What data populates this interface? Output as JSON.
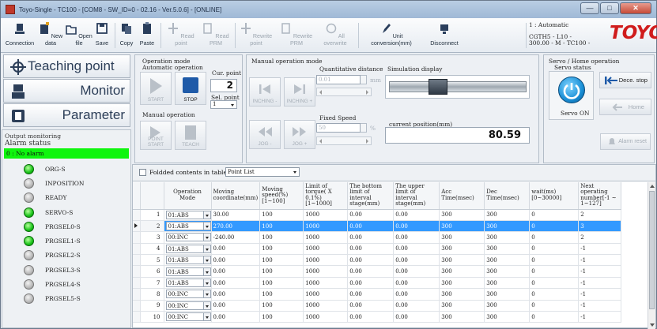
{
  "window": {
    "title": "Toyo-Single - TC100 - [COM8 - SW_ID=0 - 02.16 - Ver.5.0.6] - [ONLINE]",
    "min_label": "—",
    "max_label": "□",
    "close_label": "✕"
  },
  "toolbar": {
    "connection": "Connection",
    "new_data": "New data",
    "open_file": "Open file",
    "save": "Save",
    "copy": "Copy",
    "paste": "Paste",
    "read_point": "Read point",
    "read_prm": "Read PRM",
    "rewrite_point": "Rewrite point",
    "rewrite_prm": "Rewrite PRM",
    "all_overwrite": "All overwrite",
    "unit_conversion": "Unit conversion(mm)",
    "disconnect": "Disconnect"
  },
  "robot_info": {
    "line1": "1 : Automatic",
    "line2": "CGTH5 - L10 -",
    "line3": "300.00 - M - TC100 -",
    "logo": "TOYO"
  },
  "nav": {
    "teaching_point": "Teaching point",
    "monitor": "Monitor",
    "parameter": "Parameter"
  },
  "output_monitoring": {
    "title": "Output monitoring",
    "alarm_status": "Alarm status",
    "alarm_value": "0 : No alarm",
    "signals": [
      {
        "name": "ORG-S",
        "state": "on"
      },
      {
        "name": "INPOSITION",
        "state": "off"
      },
      {
        "name": "READY",
        "state": "off"
      },
      {
        "name": "SERVO-S",
        "state": "on"
      },
      {
        "name": "PRGSEL0-S",
        "state": "on"
      },
      {
        "name": "PRGSEL1-S",
        "state": "on"
      },
      {
        "name": "PRGSEL2-S",
        "state": "off"
      },
      {
        "name": "PRGSEL3-S",
        "state": "off"
      },
      {
        "name": "PRGSEL4-S",
        "state": "off"
      },
      {
        "name": "PRGSEL5-S",
        "state": "off"
      }
    ]
  },
  "operation_mode": {
    "title": "Operation mode",
    "automatic": "Automatic operation",
    "start": "START",
    "stop": "STOP",
    "cur_point_label": "Cur. point",
    "cur_point_value": "2",
    "sel_point_label": "Sel. point",
    "sel_point_value": "1",
    "manual": "Manual operation",
    "point_start": "POINT START",
    "teach": "TEACH"
  },
  "manual_mode": {
    "title": "Manual operation mode",
    "inching_minus": "INCHING -",
    "inching_plus": "INCHING +",
    "jog_minus": "JOG -",
    "jog_plus": "JOG +",
    "qty_distance_label": "Quantitative distance",
    "qty_distance_value": "0.01",
    "qty_unit": "mm",
    "fixed_speed_label": "Fixed Speed",
    "fixed_speed_value": "50",
    "fixed_speed_unit": "%",
    "sim_label": "Simulation display",
    "current_position_label": "current position(mm)",
    "current_position_value": "80.59"
  },
  "servo": {
    "title": "Servo / Home operation",
    "status_label": "Servo status",
    "servo_on": "Servo ON",
    "dece_stop": "Dece. stop",
    "home": "Home",
    "alarm_reset": "Alarm reset"
  },
  "table": {
    "folded_label": "Foldded contents in table",
    "view_select": "Point List",
    "headers": [
      "",
      "Operation Mode",
      "Moving coordinate(mm)",
      "Moving speed(%)[1~100]",
      "Limit of torque( X 0.1%)[1~1000]",
      "The bottom limit of interval stage(mm)",
      "The upper limit of interval stage(mm)",
      "Acc Time(msec)",
      "Dec Time(msec)",
      "wait(ms)[0~30000]",
      "Next operating number[-1 ~ 1~127]"
    ],
    "rows": [
      {
        "n": "1",
        "mode": "01:ABS",
        "coord": "30.00",
        "speed": "100",
        "torque": "1000",
        "bottom": "0.00",
        "upper": "0.00",
        "acc": "300",
        "dec": "300",
        "wait": "0",
        "next": "2"
      },
      {
        "n": "2",
        "mode": "01:ABS",
        "coord": "270.00",
        "speed": "100",
        "torque": "1000",
        "bottom": "0.00",
        "upper": "0.00",
        "acc": "300",
        "dec": "300",
        "wait": "0",
        "next": "3"
      },
      {
        "n": "3",
        "mode": "00:INC",
        "coord": "-240.00",
        "speed": "100",
        "torque": "1000",
        "bottom": "0.00",
        "upper": "0.00",
        "acc": "300",
        "dec": "300",
        "wait": "0",
        "next": "2"
      },
      {
        "n": "4",
        "mode": "01:ABS",
        "coord": "0.00",
        "speed": "100",
        "torque": "1000",
        "bottom": "0.00",
        "upper": "0.00",
        "acc": "300",
        "dec": "300",
        "wait": "0",
        "next": "-1"
      },
      {
        "n": "5",
        "mode": "01:ABS",
        "coord": "0.00",
        "speed": "100",
        "torque": "1000",
        "bottom": "0.00",
        "upper": "0.00",
        "acc": "300",
        "dec": "300",
        "wait": "0",
        "next": "-1"
      },
      {
        "n": "6",
        "mode": "01:ABS",
        "coord": "0.00",
        "speed": "100",
        "torque": "1000",
        "bottom": "0.00",
        "upper": "0.00",
        "acc": "300",
        "dec": "300",
        "wait": "0",
        "next": "-1"
      },
      {
        "n": "7",
        "mode": "01:ABS",
        "coord": "0.00",
        "speed": "100",
        "torque": "1000",
        "bottom": "0.00",
        "upper": "0.00",
        "acc": "300",
        "dec": "300",
        "wait": "0",
        "next": "-1"
      },
      {
        "n": "8",
        "mode": "00:INC",
        "coord": "0.00",
        "speed": "100",
        "torque": "1000",
        "bottom": "0.00",
        "upper": "0.00",
        "acc": "300",
        "dec": "300",
        "wait": "0",
        "next": "-1"
      },
      {
        "n": "9",
        "mode": "00:INC",
        "coord": "0.00",
        "speed": "100",
        "torque": "1000",
        "bottom": "0.00",
        "upper": "0.00",
        "acc": "300",
        "dec": "300",
        "wait": "0",
        "next": "-1"
      },
      {
        "n": "10",
        "mode": "00:INC",
        "coord": "0.00",
        "speed": "100",
        "torque": "1000",
        "bottom": "0.00",
        "upper": "0.00",
        "acc": "300",
        "dec": "300",
        "wait": "0",
        "next": "-1"
      }
    ],
    "selected_row": 1
  },
  "colors": {
    "alarm_ok": "#0ef50e",
    "selected_row": "#3399ff",
    "logo_red": "#d01c1c",
    "stop_blue": "#1e5aa8"
  }
}
